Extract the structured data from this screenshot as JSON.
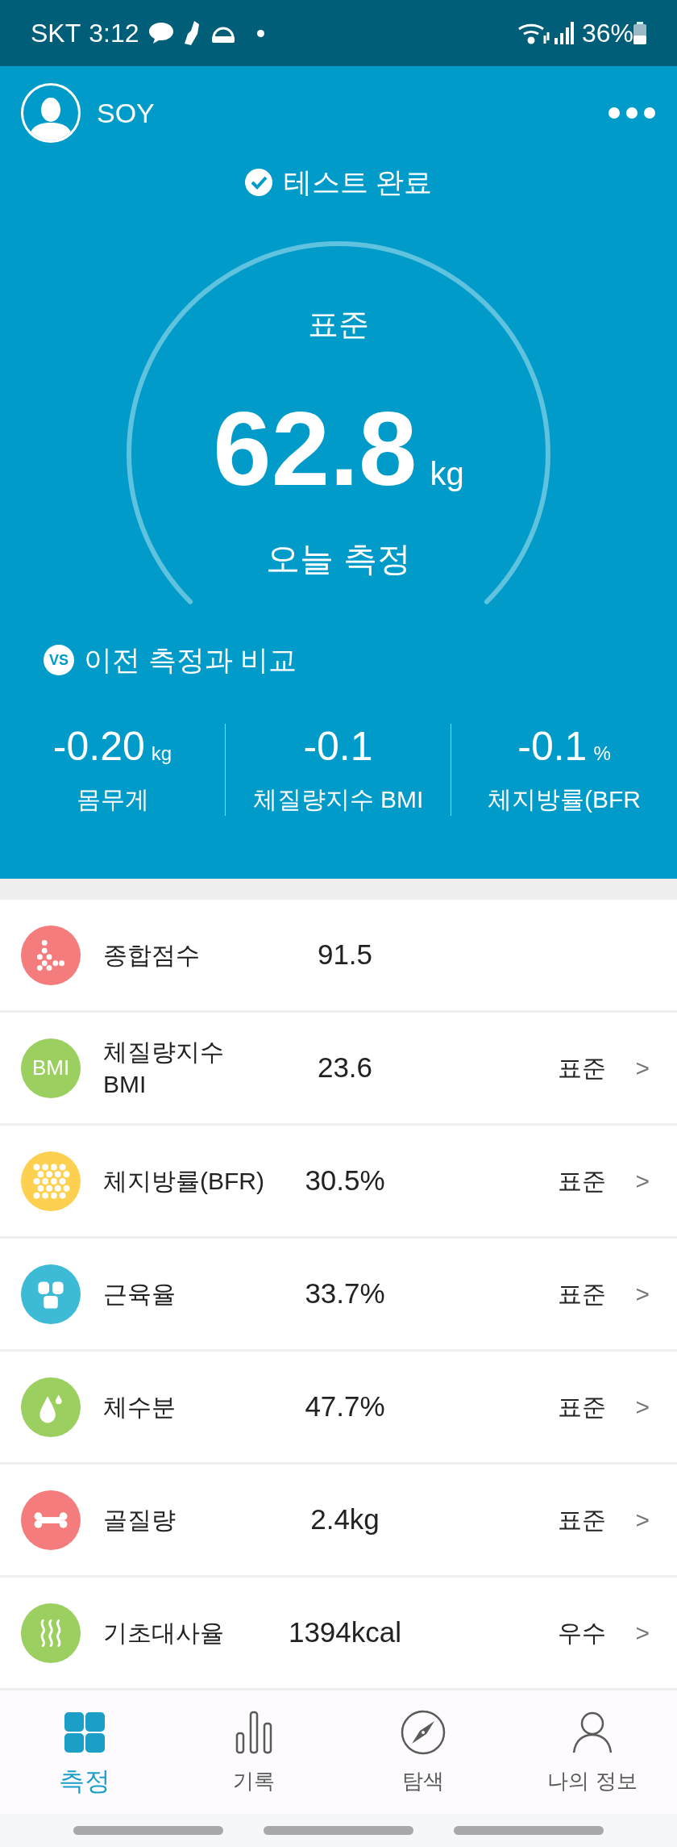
{
  "status_bar": {
    "carrier": "SKT",
    "time": "3:12",
    "battery": "36%"
  },
  "header": {
    "user_name": "SOY"
  },
  "test_status": "테스트 완료",
  "gauge": {
    "grade": "표준",
    "value": "62.8",
    "unit": "kg",
    "caption": "오늘 측정"
  },
  "compare": {
    "title": "이전 측정과 비교",
    "icon_text": "VS",
    "items": [
      {
        "value": "-0.20",
        "unit": "kg",
        "label": "몸무게"
      },
      {
        "value": "-0.1",
        "label": "체질량지수 BMI"
      },
      {
        "value": "-0.1",
        "unit": "%",
        "label": "체지방률(BFR"
      }
    ]
  },
  "metrics": [
    {
      "kind": "score",
      "color": "#f47c7c",
      "label": "종합점수",
      "value": "91.5"
    },
    {
      "kind": "bmi",
      "color": "#9bcf5f",
      "icon_text": "BMI",
      "label": "체질량지수 BMI",
      "value": "23.6",
      "status": "표준",
      "arrow": ">"
    },
    {
      "kind": "fat",
      "color": "#fdd04f",
      "label": "체지방률(BFR)",
      "value": "30.5%",
      "status": "표준",
      "arrow": ">"
    },
    {
      "kind": "muscle",
      "color": "#3cbad6",
      "label": "근육율",
      "value": "33.7%",
      "status": "표준",
      "arrow": ">"
    },
    {
      "kind": "water",
      "color": "#9bcf5f",
      "label": "체수분",
      "value": "47.7%",
      "status": "표준",
      "arrow": ">"
    },
    {
      "kind": "bone",
      "color": "#f47c7c",
      "label": "골질량",
      "value": "2.4kg",
      "status": "표준",
      "arrow": ">"
    },
    {
      "kind": "bmr",
      "color": "#9bcf5f",
      "label": "기초대사율",
      "value": "1394kcal",
      "status": "우수",
      "arrow": ">"
    }
  ],
  "bottom_nav": [
    {
      "kind": "measure",
      "label": "측정",
      "selected": true
    },
    {
      "kind": "records",
      "label": "기록",
      "selected": false
    },
    {
      "kind": "explore",
      "label": "탐색",
      "selected": false
    },
    {
      "kind": "profile",
      "label": "나의 정보",
      "selected": false
    }
  ]
}
